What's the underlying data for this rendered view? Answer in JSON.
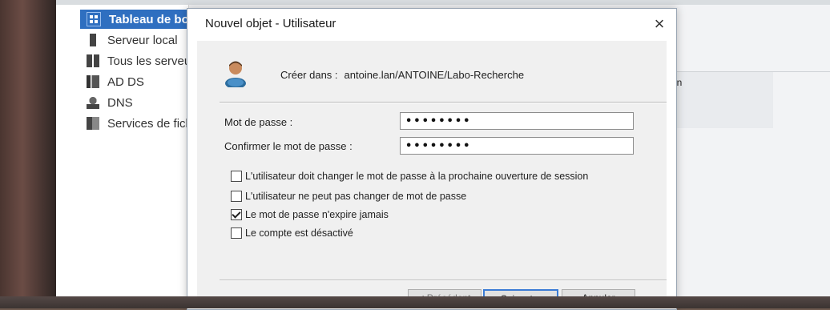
{
  "dialog": {
    "title": "Nouvel objet - Utilisateur",
    "close": "×",
    "create_in_label": "Créer dans :",
    "create_in_path": "antoine.lan/ANTOINE/Labo-Recherche",
    "password_label": "Mot de passe :",
    "password_value": "••••••••",
    "confirm_label": "Confirmer le mot de passe :",
    "confirm_value": "••••••••",
    "checkboxes": [
      {
        "label": "L'utilisateur doit changer le mot de passe à la prochaine ouverture de session",
        "checked": false
      },
      {
        "label": "L'utilisateur ne peut pas changer de mot de passe",
        "checked": false
      },
      {
        "label": "Le mot de passe n'expire jamais",
        "checked": true
      },
      {
        "label": "Le compte est désactivé",
        "checked": false
      }
    ],
    "buttons": {
      "back": "< Précédent",
      "next": "Suivant >",
      "cancel": "Annuler"
    }
  },
  "server_manager": {
    "sidebar": [
      {
        "label": "Tableau de bord",
        "icon": "dashboard-icon"
      },
      {
        "label": "Serveur local",
        "icon": "server-icon"
      },
      {
        "label": "Tous les serveurs",
        "icon": "servers-icon"
      },
      {
        "label": "AD DS",
        "icon": "adds-icon"
      },
      {
        "label": "DNS",
        "icon": "dns-icon"
      },
      {
        "label": "Services de fichiers",
        "icon": "services-icon"
      }
    ],
    "column_header": "on"
  }
}
